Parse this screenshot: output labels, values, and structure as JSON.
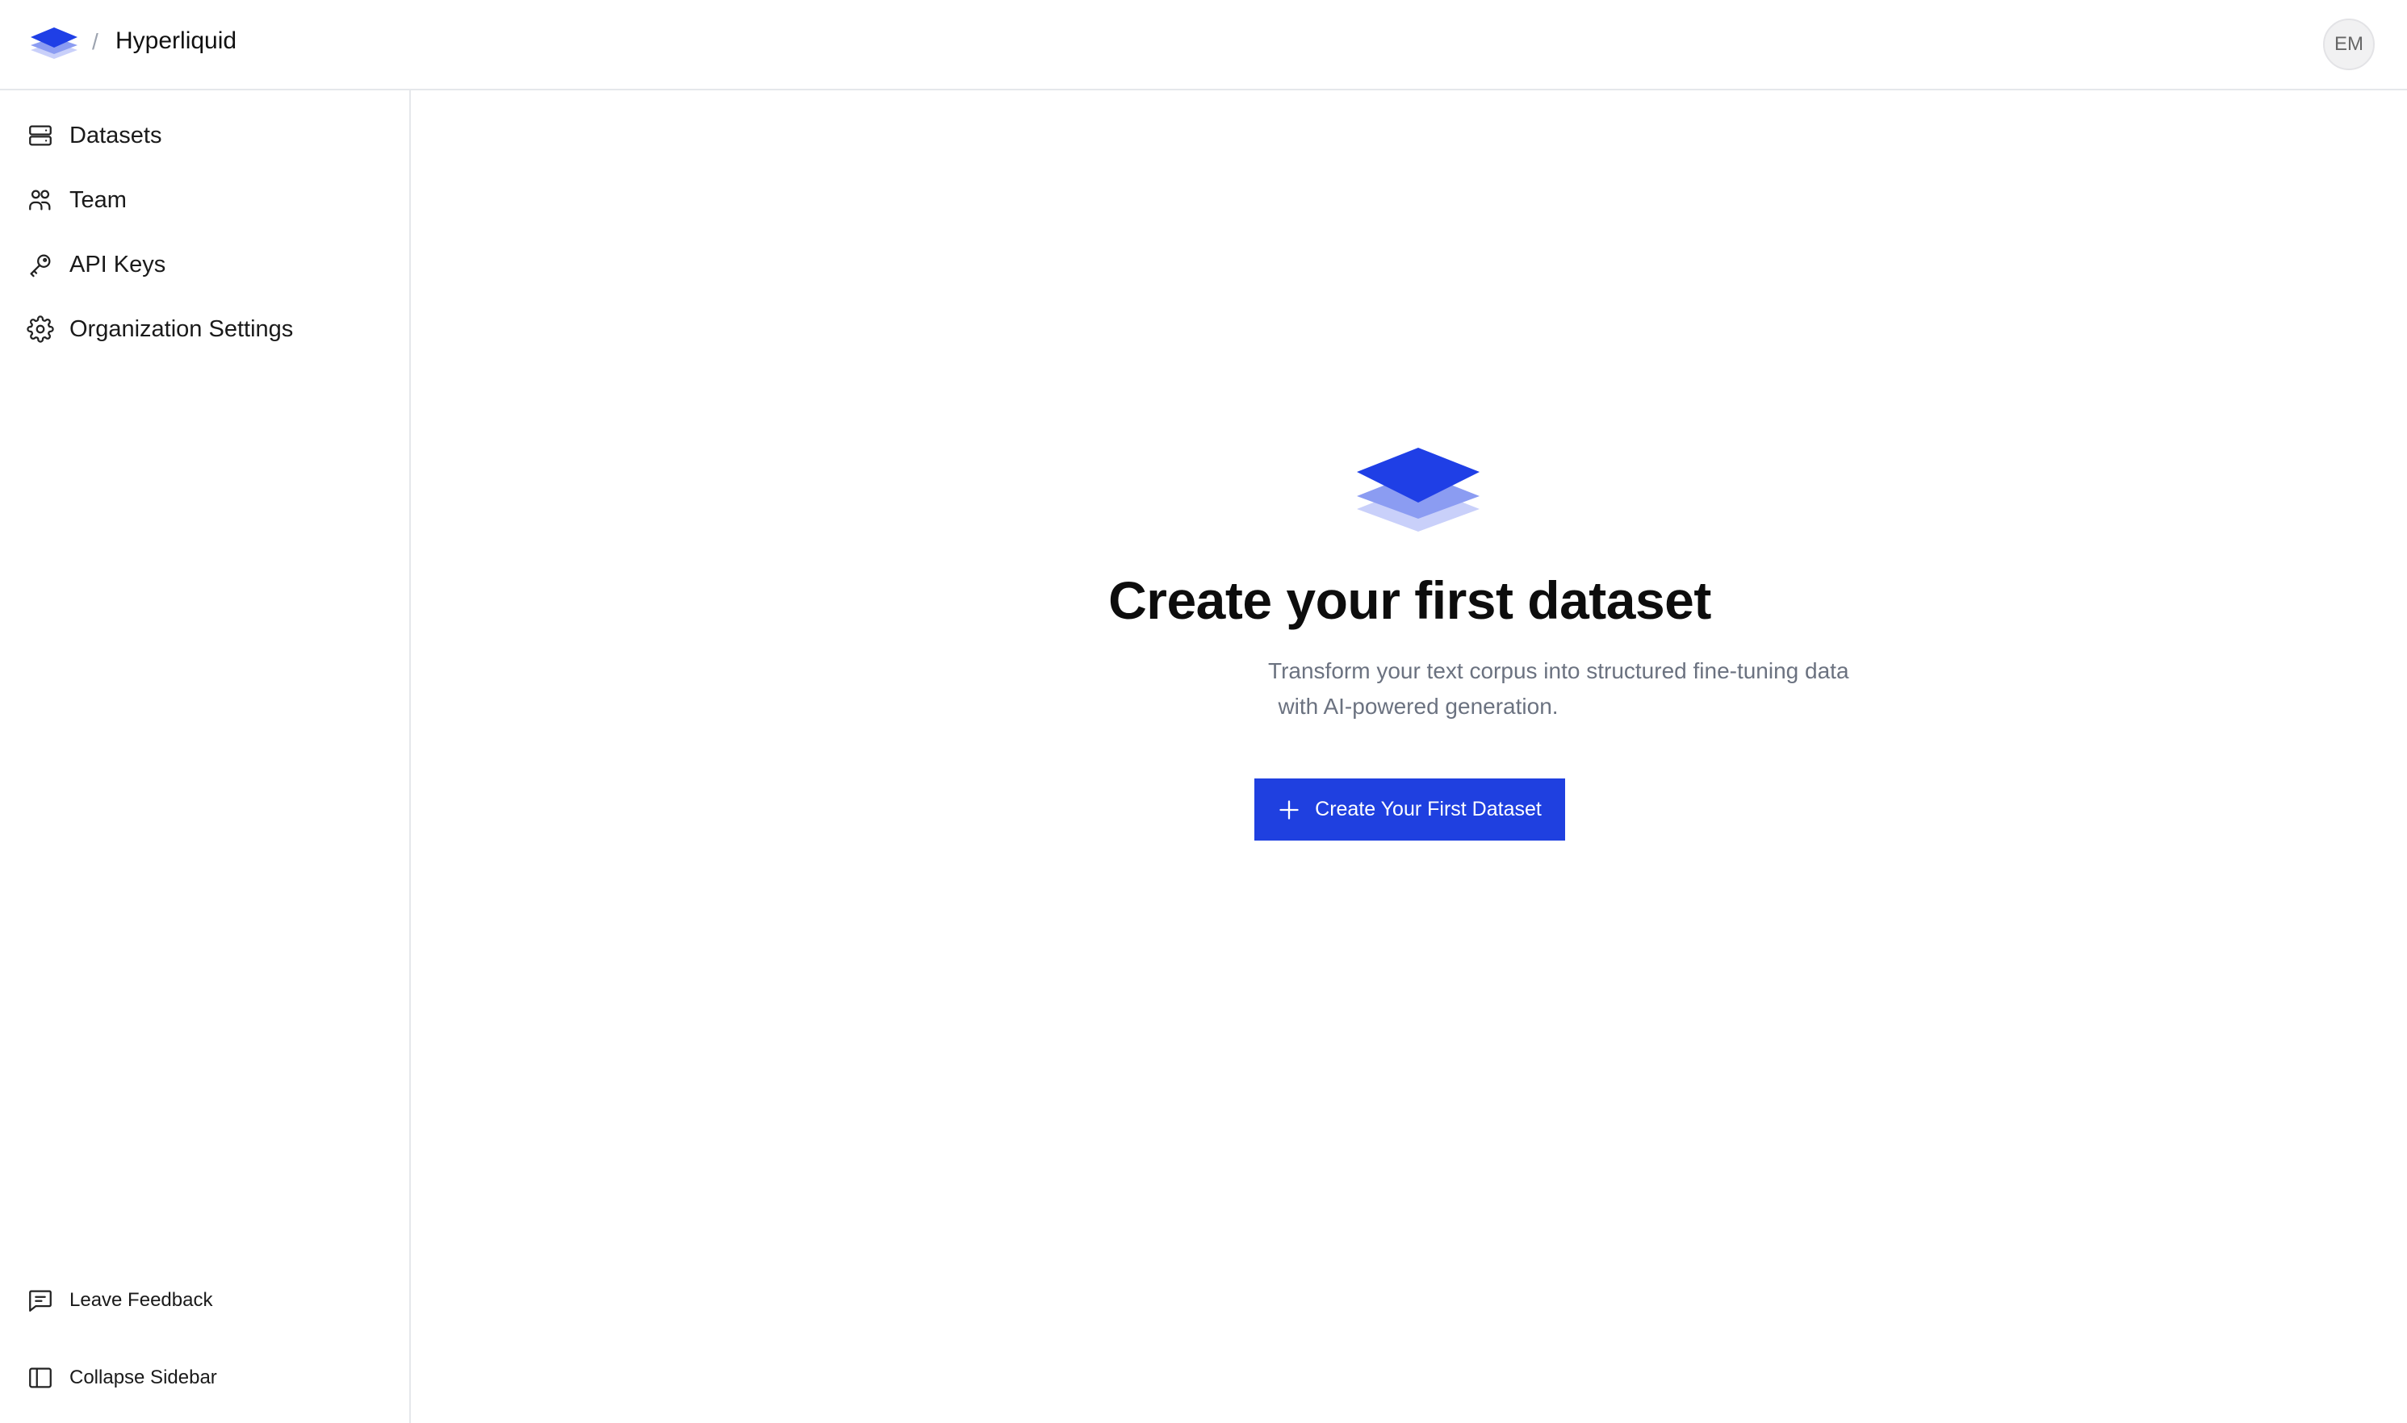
{
  "header": {
    "logo_icon": "layers-logo-icon",
    "breadcrumb_separator": "/",
    "org_name": "Hyperliquid",
    "avatar_initials": "EM"
  },
  "sidebar": {
    "items": [
      {
        "label": "Datasets",
        "icon": "database-icon"
      },
      {
        "label": "Team",
        "icon": "users-icon"
      },
      {
        "label": "API Keys",
        "icon": "key-icon"
      },
      {
        "label": "Organization Settings",
        "icon": "gear-icon"
      }
    ],
    "footer": {
      "feedback_label": "Leave Feedback",
      "collapse_label": "Collapse Sidebar"
    }
  },
  "empty_state": {
    "title": "Create your first dataset",
    "description_line1": "Transform your text corpus into structured fine-tuning data",
    "description_line2": "with AI-powered generation.",
    "button_label": "Create Your First Dataset"
  },
  "colors": {
    "accent": "#1f40e0",
    "logo_top": "#1f3fe6",
    "logo_mid": "#8b9cf2",
    "logo_bottom": "#c9d0fa"
  }
}
